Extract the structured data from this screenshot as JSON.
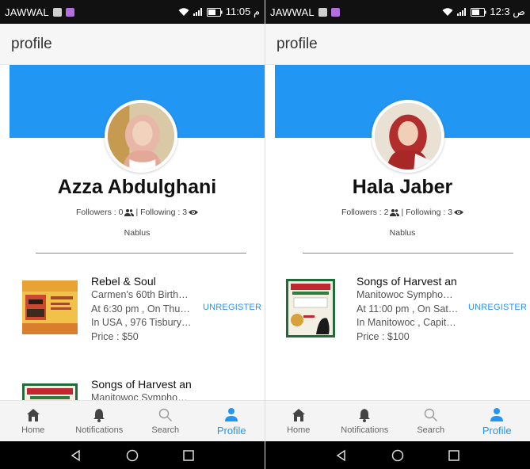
{
  "screens": [
    {
      "status": {
        "carrier": "JAWWAL",
        "time": "11:05 م"
      },
      "appbar": {
        "title": "profile"
      },
      "profile": {
        "name": "Azza Abdulghani",
        "followers_label": "Followers : 0",
        "following_label": "| Following : 3",
        "city": "Nablus"
      },
      "events": [
        {
          "title": "Rebel & Soul",
          "desc": "Carmen's 60th Birth…",
          "when": "At 6:30 pm , On Thu…",
          "where": "In USA , 976 Tisbury…",
          "price": "Price : $50",
          "action": "UNREGISTER"
        },
        {
          "title": "Songs of Harvest an",
          "desc": "Manitowoc Sympho…",
          "when": "",
          "where": "",
          "price": "",
          "action": ""
        }
      ],
      "nav": [
        {
          "label": "Home",
          "icon": "home-icon"
        },
        {
          "label": "Notifications",
          "icon": "bell-icon"
        },
        {
          "label": "Search",
          "icon": "search-icon"
        },
        {
          "label": "Profile",
          "icon": "person-icon"
        }
      ]
    },
    {
      "status": {
        "carrier": "JAWWAL",
        "time": "12:3 ص"
      },
      "appbar": {
        "title": "profile"
      },
      "profile": {
        "name": "Hala Jaber",
        "followers_label": "Followers : 2",
        "following_label": "| Following : 3",
        "city": "Nablus"
      },
      "events": [
        {
          "title": "Songs of Harvest an",
          "desc": "Manitowoc Sympho…",
          "when": "At 11:00 pm , On Sat…",
          "where": "In Manitowoc , Capit…",
          "price": "Price : $100",
          "action": "UNREGISTER"
        }
      ],
      "nav": [
        {
          "label": "Home",
          "icon": "home-icon"
        },
        {
          "label": "Notifications",
          "icon": "bell-icon"
        },
        {
          "label": "Search",
          "icon": "search-icon"
        },
        {
          "label": "Profile",
          "icon": "person-icon"
        }
      ]
    }
  ],
  "colors": {
    "accent": "#2196f3",
    "statusbar": "#111111",
    "appbar": "#f6f6f6"
  }
}
